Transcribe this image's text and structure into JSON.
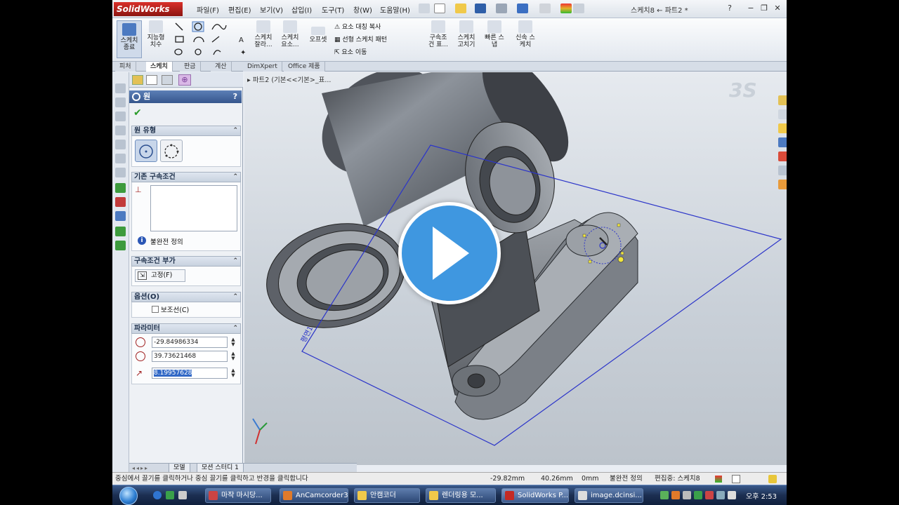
{
  "app": {
    "logo_text": "SolidWorks",
    "document_title": "스케치8 ← 파트2 *",
    "menus": [
      "파일(F)",
      "편집(E)",
      "보기(V)",
      "삽입(I)",
      "도구(T)",
      "창(W)",
      "도움말(H)"
    ]
  },
  "command_manager": {
    "exit_sketch": "스케치\n종료",
    "smart_dim": "지능형\n치수",
    "sketch_trim": "스케치\n잘라...",
    "sketch_convert": "스케치\n요소...",
    "offset": "오프셋",
    "mirror": "요소 대칭 복사",
    "linear_pattern": "선형 스케치 패턴",
    "move": "요소 이동",
    "relations": "구속조\n건 표...",
    "repair": "스케치\n고치기",
    "quick_snaps": "빠른 스\n냅",
    "rapid_sketch": "신속 스\n케치"
  },
  "tabs": [
    "피처",
    "스케치",
    "판금",
    "계산",
    "DimXpert",
    "Office 제품"
  ],
  "active_tab": "스케치",
  "feature_tree_path": "파트2 (기본<<기본>_표...",
  "property_manager": {
    "title": "원",
    "help": "?",
    "circle_type_header": "원 유형",
    "existing_relations_header": "기존 구속조건",
    "status_text": "불완전 정의",
    "add_relations_header": "구속조건 부가",
    "fix_label": "고정(F)",
    "options_header": "옵션(O)",
    "construction_label": "보조선(C)",
    "parameters_header": "파라미터",
    "param_x": "-29.84986334",
    "param_y": "39.73621468",
    "param_r": "8.19957628"
  },
  "bottom_tabs": [
    "모델",
    "모션 스터디 1"
  ],
  "status_bar": {
    "hint": "중심에서 끌기를 클릭하거나 중심 끌기를 클릭하고 반경을 클릭합니다",
    "x": "-29.82mm",
    "y": "40.26mm",
    "z": "0mm",
    "state": "불완전 정의",
    "editing": "편집중: 스케치8"
  },
  "sketch_label": "평면1",
  "taskbar": {
    "items": [
      "마작 마시당...",
      "AnCamcorder3",
      "안캠코더",
      "렌더링용 모...",
      "SolidWorks P...",
      "image.dcinsi..."
    ],
    "clock": "오후 2:53"
  },
  "colors": {
    "accent": "#3f97e0",
    "sketch_blue": "#2c35c9",
    "selection_yellow": "#f3e83a"
  }
}
